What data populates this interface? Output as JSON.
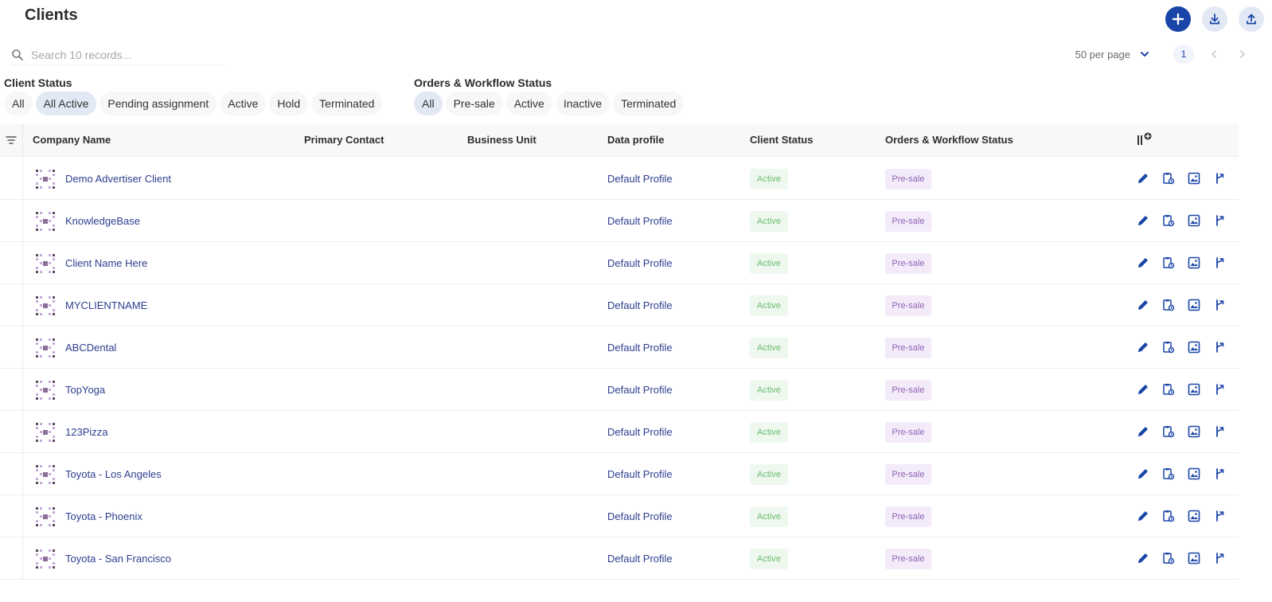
{
  "page": {
    "title": "Clients"
  },
  "colors": {
    "primary": "#1a45a8",
    "link": "#2d3f8f",
    "active_text": "#6cbc71",
    "active_bg": "#eef8ee",
    "presale_text": "#8e62b3",
    "presale_bg": "#f3ebf9"
  },
  "toolbar": {
    "add_icon": "plus-icon",
    "download_icon": "download-icon",
    "upload_icon": "upload-icon"
  },
  "search": {
    "placeholder": "Search 10 records..."
  },
  "pagination": {
    "per_page": "50 per page",
    "current_page": "1"
  },
  "filters": {
    "client_status": {
      "label": "Client Status",
      "options": [
        "All",
        "All Active",
        "Pending assignment",
        "Active",
        "Hold",
        "Terminated"
      ],
      "selected": "All Active"
    },
    "orders_status": {
      "label": "Orders & Workflow Status",
      "options": [
        "All",
        "Pre-sale",
        "Active",
        "Inactive",
        "Terminated"
      ],
      "selected": "All"
    }
  },
  "table": {
    "columns": [
      "Company Name",
      "Primary Contact",
      "Business Unit",
      "Data profile",
      "Client Status",
      "Orders & Workflow Status"
    ],
    "rows": [
      {
        "company": "Demo Advertiser Client",
        "primary_contact": "",
        "business_unit": "",
        "profile": "Default Profile",
        "client_status": "Active",
        "orders_status": "Pre-sale"
      },
      {
        "company": "KnowledgeBase",
        "primary_contact": "",
        "business_unit": "",
        "profile": "Default Profile",
        "client_status": "Active",
        "orders_status": "Pre-sale"
      },
      {
        "company": "Client Name Here",
        "primary_contact": "",
        "business_unit": "",
        "profile": "Default Profile",
        "client_status": "Active",
        "orders_status": "Pre-sale"
      },
      {
        "company": "MYCLIENTNAME",
        "primary_contact": "",
        "business_unit": "",
        "profile": "Default Profile",
        "client_status": "Active",
        "orders_status": "Pre-sale"
      },
      {
        "company": "ABCDental",
        "primary_contact": "",
        "business_unit": "",
        "profile": "Default Profile",
        "client_status": "Active",
        "orders_status": "Pre-sale"
      },
      {
        "company": "TopYoga",
        "primary_contact": "",
        "business_unit": "",
        "profile": "Default Profile",
        "client_status": "Active",
        "orders_status": "Pre-sale"
      },
      {
        "company": "123Pizza",
        "primary_contact": "",
        "business_unit": "",
        "profile": "Default Profile",
        "client_status": "Active",
        "orders_status": "Pre-sale"
      },
      {
        "company": "Toyota - Los Angeles",
        "primary_contact": "",
        "business_unit": "",
        "profile": "Default Profile",
        "client_status": "Active",
        "orders_status": "Pre-sale"
      },
      {
        "company": "Toyota - Phoenix",
        "primary_contact": "",
        "business_unit": "",
        "profile": "Default Profile",
        "client_status": "Active",
        "orders_status": "Pre-sale"
      },
      {
        "company": "Toyota - San Francisco",
        "primary_contact": "",
        "business_unit": "",
        "profile": "Default Profile",
        "client_status": "Active",
        "orders_status": "Pre-sale"
      }
    ],
    "row_action_icons": [
      "pencil-icon",
      "clipboard-icon",
      "image-icon",
      "branch-icon"
    ]
  }
}
